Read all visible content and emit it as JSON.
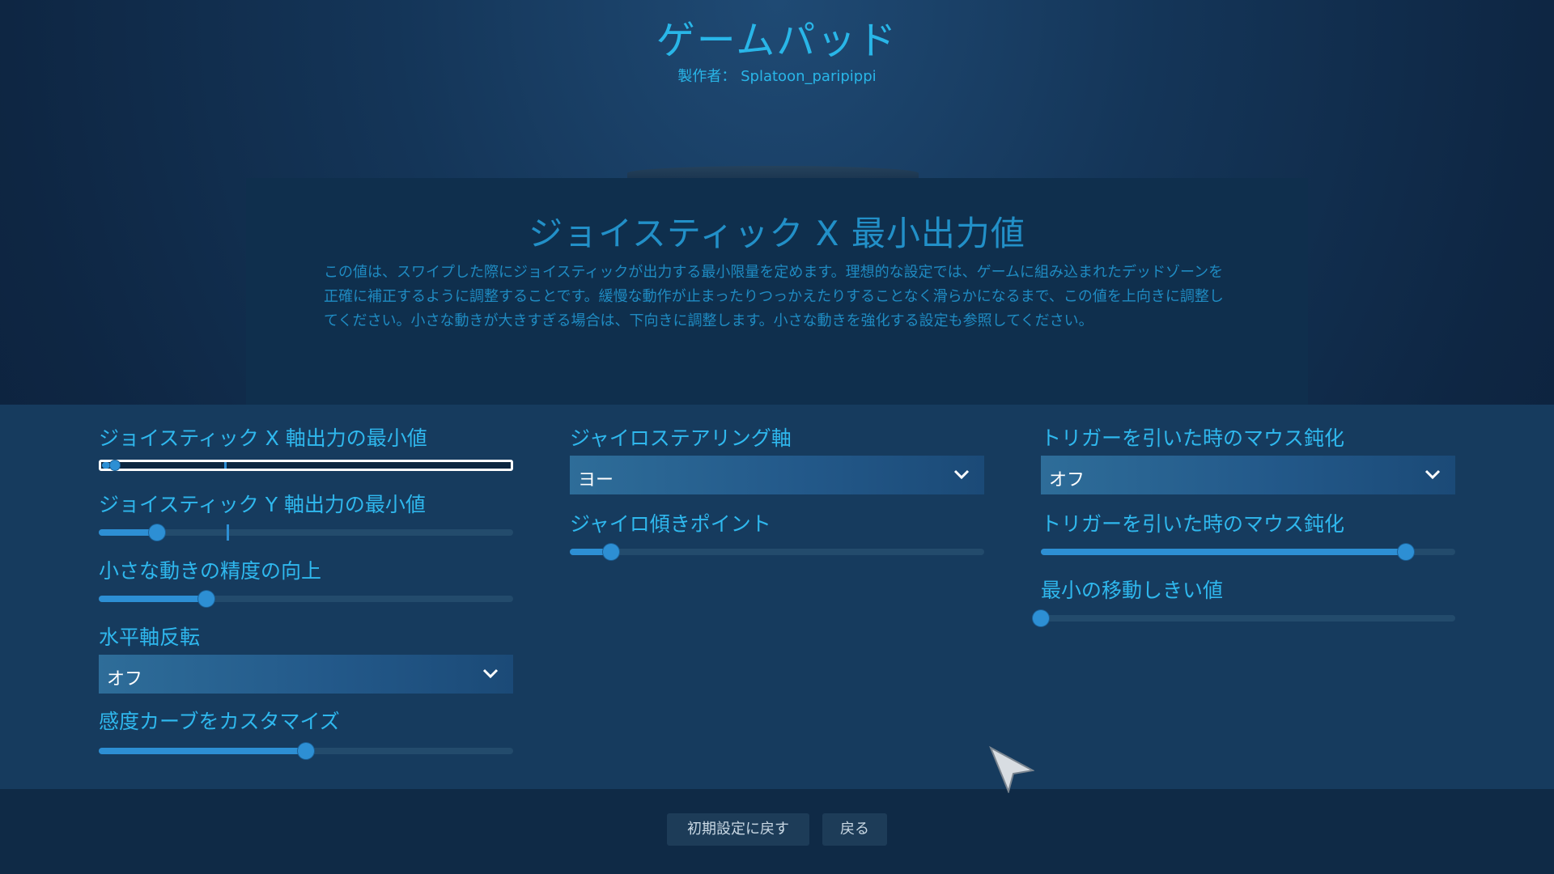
{
  "header": {
    "title": "ゲームパッド",
    "author_label": "製作者：",
    "author": "Splatoon_paripippi"
  },
  "info": {
    "title": "ジョイスティック X 最小出力値",
    "description": "この値は、スワイプした際にジョイスティックが出力する最小限量を定めます。理想的な設定では、ゲームに組み込まれたデッドゾーンを正確に補正するように調整することです。緩慢な動作が止まったりつっかえたりすることなく滑らかになるまで、この値を上向きに調整してください。小さな動きが大きすぎる場合は、下向きに調整します。小さな動きを強化する設定も参照してください。"
  },
  "settings": {
    "col1": {
      "stick_x_label": "ジョイスティック X 軸出力の最小値",
      "stick_x_value": 0.02,
      "stick_x_default": 0.31,
      "stick_y_label": "ジョイスティック Y 軸出力の最小値",
      "stick_y_value": 0.14,
      "stick_y_default": 0.31,
      "precision_label": "小さな動きの精度の向上",
      "precision_value": 0.26,
      "invert_h_label": "水平軸反転",
      "invert_h_value": "オフ",
      "curve_label": "感度カーブをカスタマイズ",
      "curve_value": 0.5
    },
    "col2": {
      "gyro_axis_label": "ジャイロステアリング軸",
      "gyro_axis_value": "ヨー",
      "gyro_tilt_label": "ジャイロ傾きポイント",
      "gyro_tilt_value": 0.1
    },
    "col3": {
      "trigger_damp_label": "トリガーを引いた時のマウス鈍化",
      "trigger_damp_value": "オフ",
      "trigger_damp2_label": "トリガーを引いた時のマウス鈍化",
      "trigger_damp2_value": 0.88,
      "min_move_label": "最小の移動しきい値",
      "min_move_value": 0.0
    }
  },
  "footer": {
    "reset_label": "初期設定に戻す",
    "back_label": "戻る"
  },
  "colors": {
    "accent": "#2fb8ee",
    "slider": "#2d8fd4"
  }
}
